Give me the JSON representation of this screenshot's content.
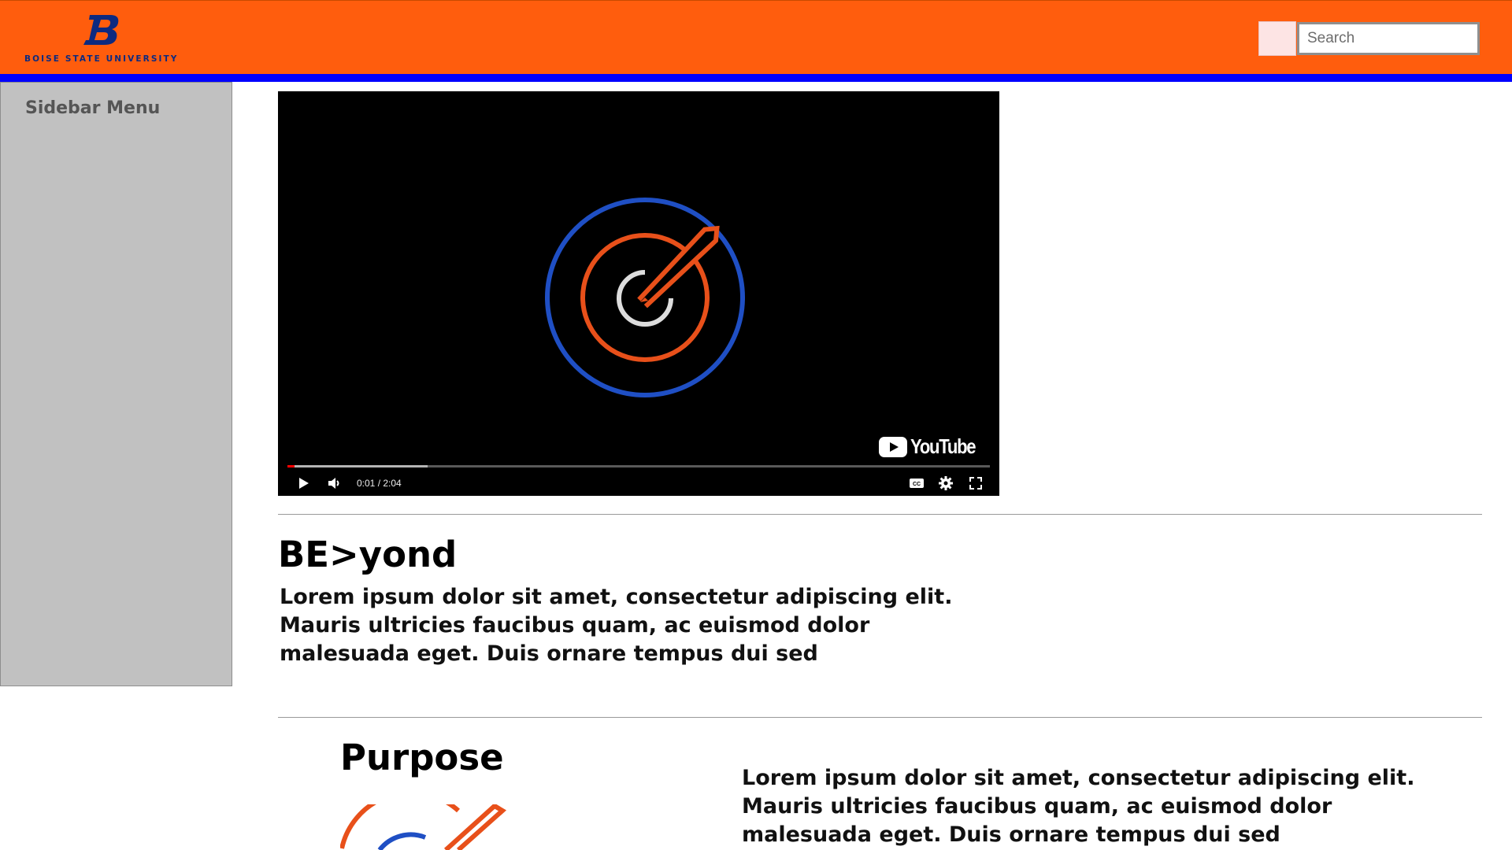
{
  "header": {
    "logo_text": "BOISE STATE UNIVERSITY",
    "search_placeholder": "Search",
    "colors": {
      "bar": "#ff5d0d",
      "rule": "#0000ff",
      "logo": "#0d2a80"
    }
  },
  "sidebar": {
    "title": "Sidebar Menu"
  },
  "video": {
    "brand": "YouTube",
    "time": "0:01 / 2:04",
    "played_fraction": 0.008,
    "buffered_fraction": 0.2,
    "icons": [
      "play-icon",
      "volume-icon",
      "captions-icon",
      "settings-icon",
      "fullscreen-icon"
    ]
  },
  "sections": {
    "beyond": {
      "heading": "BE>yond",
      "body": "Lorem ipsum dolor sit amet, consectetur adipiscing elit. Mauris ultricies faucibus quam, ac euismod dolor malesuada eget. Duis ornare tempus dui sed"
    },
    "purpose": {
      "heading": "Purpose",
      "body": "Lorem ipsum dolor sit amet, consectetur adipiscing elit. Mauris ultricies faucibus quam, ac euismod dolor malesuada eget. Duis ornare tempus dui sed"
    }
  }
}
